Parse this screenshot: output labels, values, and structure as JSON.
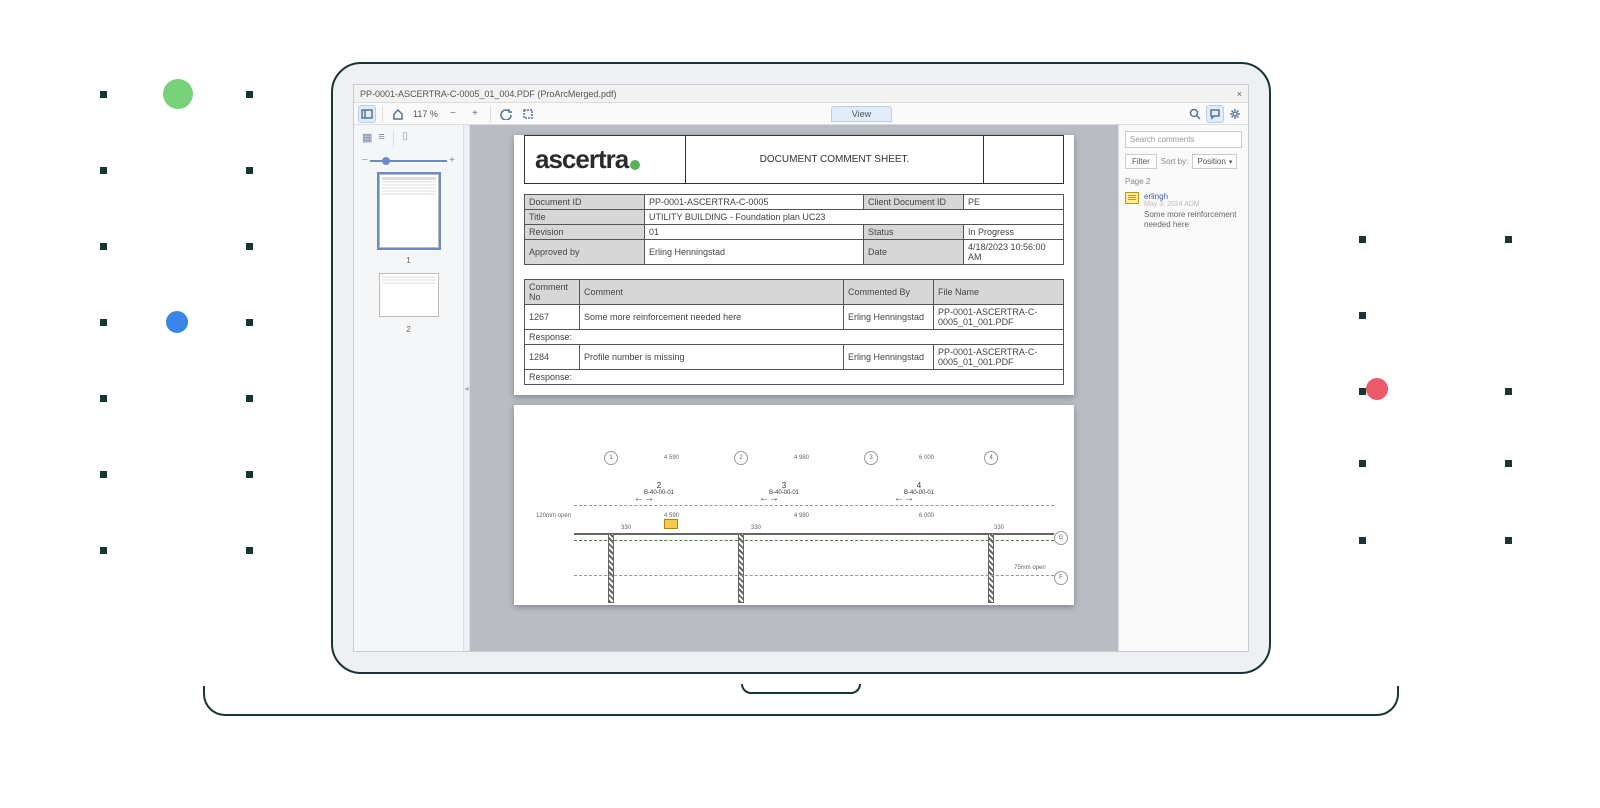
{
  "titlebar": {
    "filename": "PP-0001-ASCERTRA-C-0005_01_004.PDF (ProArcMerged.pdf)",
    "close": "×"
  },
  "toolbar": {
    "zoom": "117 %",
    "minus": "−",
    "plus": "+",
    "view_tab": "View"
  },
  "thumbs": {
    "minus": "−",
    "plus": "+",
    "page1": "1",
    "page2": "2"
  },
  "logo": {
    "text": "ascertra"
  },
  "doc_title": "DOCUMENT COMMENT SHEET.",
  "info": {
    "doc_id_h": "Document ID",
    "doc_id_v": "PP-0001-ASCERTRA-C-0005",
    "client_id_h": "Client Document ID",
    "client_id_v": "PE",
    "title_h": "Title",
    "title_v": "UTILITY BUILDING - Foundation plan UC23",
    "rev_h": "Revision",
    "rev_v": "01",
    "status_h": "Status",
    "status_v": "In Progress",
    "appr_h": "Approved by",
    "appr_v": "Erling Henningstad",
    "date_h": "Date",
    "date_v": "4/18/2023 10:56:00 AM"
  },
  "comments_table": {
    "headers": {
      "no": "Comment No",
      "comment": "Comment",
      "by": "Commented By",
      "file": "File Name"
    },
    "rows": [
      {
        "no": "1267",
        "comment": "Some more reinforcement needed here",
        "by": "Erling Henningstad",
        "file": "PP-0001-ASCERTRA-C-0005_01_001.PDF"
      },
      {
        "no": "1284",
        "comment": "Profile number is missing",
        "by": "Erling Henningstad",
        "file": "PP-0001-ASCERTRA-C-0005_01_001.PDF"
      }
    ],
    "response_label": "Response:"
  },
  "drawing": {
    "axes": [
      "1",
      "2",
      "3",
      "4"
    ],
    "dims_top": [
      "4 590",
      "4 980",
      "6 000"
    ],
    "beams": [
      {
        "n": "2",
        "code": "B-40-00-01"
      },
      {
        "n": "3",
        "code": "B-40-00-01"
      },
      {
        "n": "4",
        "code": "B-40-00-01"
      }
    ],
    "dims_mid": [
      "4 590",
      "4 980",
      "6 000"
    ],
    "col_labels": [
      "330",
      "330",
      "330"
    ],
    "axis_letters": [
      "G",
      "F"
    ],
    "note1": "120mm open",
    "note2": "75mm open"
  },
  "panel": {
    "search_ph": "Search comments",
    "filter": "Filter",
    "sortby": "Sort by:",
    "sortval": "Position",
    "page_label": "Page 2",
    "comment": {
      "author": "erlingh",
      "date": "May 3, 2024 ADM",
      "text": "Some more reinforcement needed here"
    }
  }
}
